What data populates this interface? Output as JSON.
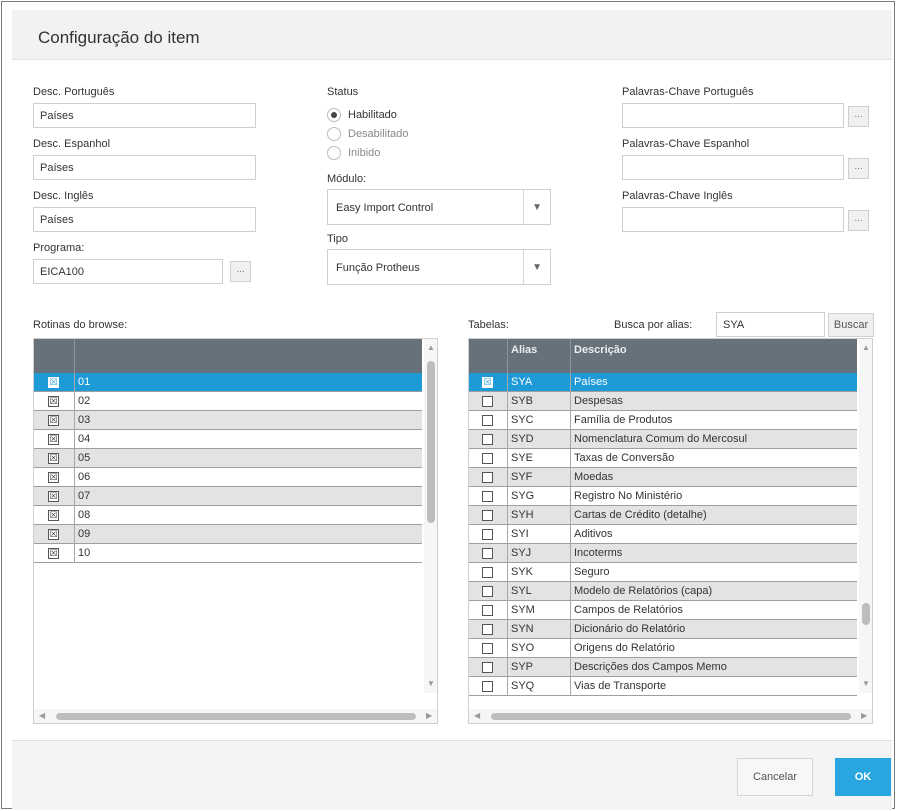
{
  "dialog": {
    "title": "Configuração do item"
  },
  "form": {
    "desc_pt": {
      "label": "Desc. Português",
      "value": "Países"
    },
    "desc_es": {
      "label": "Desc. Espanhol",
      "value": "Países"
    },
    "desc_en": {
      "label": "Desc. Inglês",
      "value": "Países"
    },
    "programa": {
      "label": "Programa:",
      "value": "EICA100",
      "button": "..."
    },
    "status": {
      "label": "Status",
      "options": [
        "Habilitado",
        "Desabilitado",
        "Inibido"
      ],
      "selected": "Habilitado"
    },
    "modulo": {
      "label": "Módulo:",
      "value": "Easy Import Control"
    },
    "tipo": {
      "label": "Tipo",
      "value": "Função Protheus"
    },
    "kw_pt": {
      "label": "Palavras-Chave Português",
      "value": "",
      "button": "..."
    },
    "kw_es": {
      "label": "Palavras-Chave Espanhol",
      "value": "",
      "button": "..."
    },
    "kw_en": {
      "label": "Palavras-Chave Inglês",
      "value": "",
      "button": "..."
    }
  },
  "rotinas": {
    "label": "Rotinas do browse:",
    "rows": [
      {
        "value": "01",
        "checked": true,
        "selected": true
      },
      {
        "value": "02",
        "checked": true
      },
      {
        "value": "03",
        "checked": true
      },
      {
        "value": "04",
        "checked": true
      },
      {
        "value": "05",
        "checked": true
      },
      {
        "value": "06",
        "checked": true
      },
      {
        "value": "07",
        "checked": true
      },
      {
        "value": "08",
        "checked": true
      },
      {
        "value": "09",
        "checked": true
      },
      {
        "value": "10",
        "checked": true
      }
    ]
  },
  "tabelas": {
    "label": "Tabelas:",
    "search_label": "Busca por alias:",
    "search_value": "SYA",
    "search_button": "Buscar",
    "columns": [
      "Alias",
      "Descrição"
    ],
    "rows": [
      {
        "alias": "SYA",
        "desc": "Países",
        "checked": true,
        "selected": true
      },
      {
        "alias": "SYB",
        "desc": "Despesas"
      },
      {
        "alias": "SYC",
        "desc": "Família de Produtos"
      },
      {
        "alias": "SYD",
        "desc": "Nomenclatura Comum do Mercosul"
      },
      {
        "alias": "SYE",
        "desc": "Taxas de Conversão"
      },
      {
        "alias": "SYF",
        "desc": "Moedas"
      },
      {
        "alias": "SYG",
        "desc": "Registro No Ministério"
      },
      {
        "alias": "SYH",
        "desc": "Cartas de Crédito (detalhe)"
      },
      {
        "alias": "SYI",
        "desc": "Aditivos"
      },
      {
        "alias": "SYJ",
        "desc": "Incoterms"
      },
      {
        "alias": "SYK",
        "desc": "Seguro"
      },
      {
        "alias": "SYL",
        "desc": "Modelo de Relatórios (capa)"
      },
      {
        "alias": "SYM",
        "desc": "Campos de Relatórios"
      },
      {
        "alias": "SYN",
        "desc": "Dicionário do Relatório"
      },
      {
        "alias": "SYO",
        "desc": "Origens do Relatório"
      },
      {
        "alias": "SYP",
        "desc": "Descrições dos Campos Memo"
      },
      {
        "alias": "SYQ",
        "desc": "Vias de Transporte"
      }
    ]
  },
  "footer": {
    "cancel": "Cancelar",
    "ok": "OK"
  },
  "colors": {
    "header": "#66717a",
    "selected_row": "#1e9ad6",
    "ok_button": "#29a6df"
  },
  "icons": {
    "checkbox_checked": "☒",
    "dropdown": "chevron-down-icon",
    "ellipsis": "ellipsis-icon"
  }
}
